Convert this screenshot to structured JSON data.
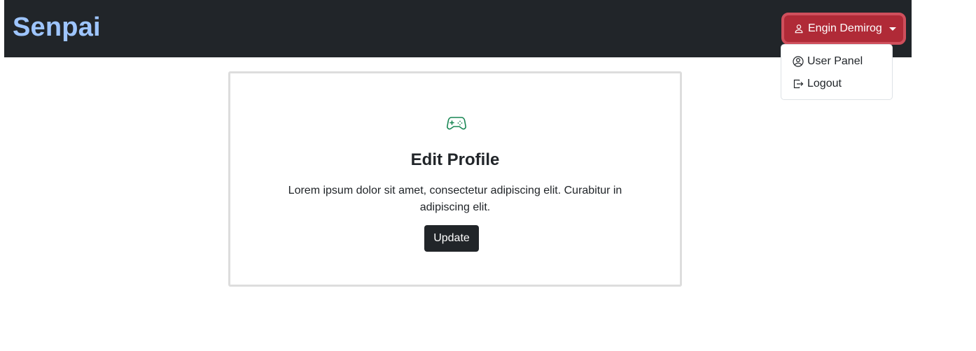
{
  "navbar": {
    "brand": "Senpai",
    "user_button": {
      "label": "Engin Demirog",
      "icon": "person-icon",
      "background_color": "#b02a37"
    },
    "dropdown": {
      "items": [
        {
          "label": "User Panel",
          "icon": "person-circle-icon"
        },
        {
          "label": "Logout",
          "icon": "logout-icon"
        }
      ]
    }
  },
  "card": {
    "icon": "gamepad-icon",
    "icon_color": "#198754",
    "title": "Edit Profile",
    "text": "Lorem ipsum dolor sit amet, consectetur adipiscing elit. Curabitur in adipiscing elit.",
    "button_label": "Update"
  },
  "colors": {
    "navbar_bg": "#212529",
    "brand": "#9ec5fe"
  }
}
